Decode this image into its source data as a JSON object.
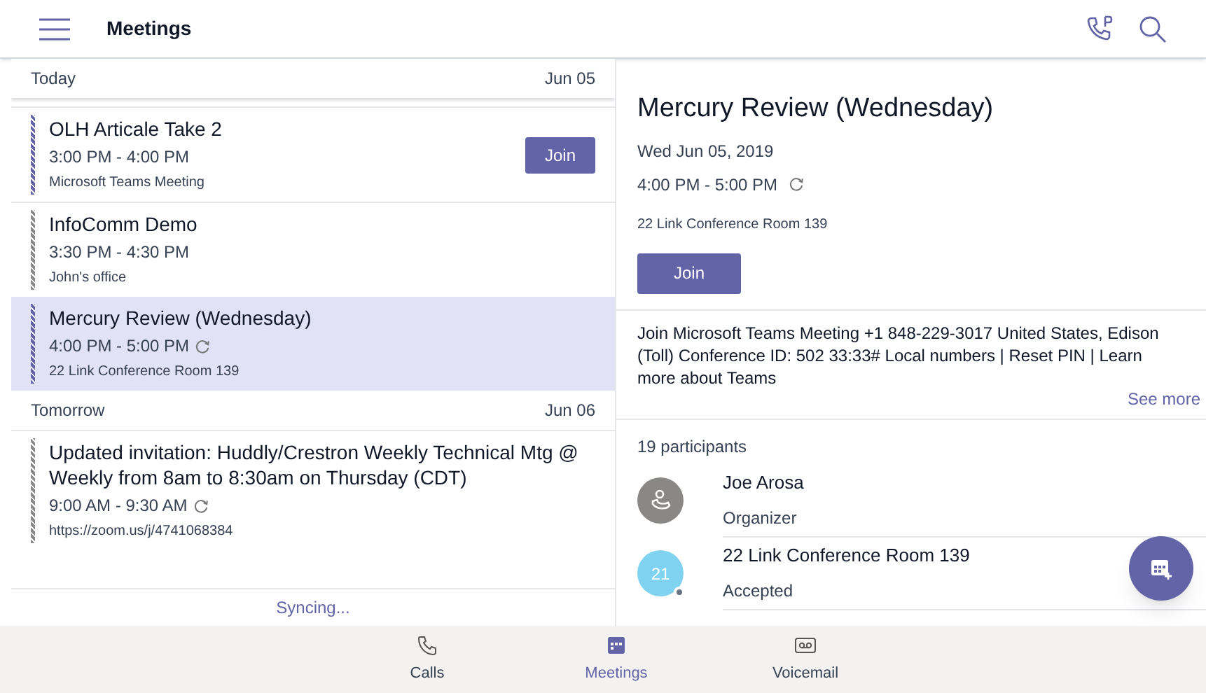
{
  "header": {
    "title": "Meetings"
  },
  "sections": [
    {
      "label": "Today",
      "date": "Jun 05",
      "meetings": [
        {
          "title": "OLH Articale Take 2",
          "time": "3:00 PM - 4:00 PM",
          "recurring": false,
          "location": "Microsoft Teams Meeting",
          "color": "#6264a7",
          "selected": false,
          "join": "Join"
        },
        {
          "title": "InfoComm Demo",
          "time": "3:30 PM - 4:30 PM",
          "recurring": false,
          "location": "John's office",
          "color": "#8a8a8a",
          "selected": false
        },
        {
          "title": "Mercury Review (Wednesday)",
          "time": "4:00 PM - 5:00 PM",
          "recurring": true,
          "location": "22 Link Conference Room 139",
          "color": "#6264a7",
          "selected": true
        }
      ]
    },
    {
      "label": "Tomorrow",
      "date": "Jun 06",
      "meetings": [
        {
          "title": "Updated invitation: Huddly/Crestron Weekly Technical Mtg @ Weekly from 8am to 8:30am on Thursday (CDT)",
          "time": "9:00 AM - 9:30 AM",
          "recurring": true,
          "location": "https://zoom.us/j/4741068384",
          "color": "#8a8a8a",
          "selected": false
        }
      ]
    }
  ],
  "sync_status": "Syncing...",
  "detail": {
    "title": "Mercury Review (Wednesday)",
    "date": "Wed Jun 05, 2019",
    "time": "4:00 PM - 5:00 PM",
    "recurring": true,
    "location": "22 Link Conference Room 139",
    "join": "Join",
    "description": "Join Microsoft Teams Meeting +1 848-229-3017 United States, Edison (Toll) Conference ID: 502 33:33# Local numbers | Reset PIN | Learn more about Teams",
    "see_more": "See more",
    "participant_count": "19 participants",
    "participants": [
      {
        "name": "Joe Arosa",
        "role": "Organizer",
        "kind": "icon"
      },
      {
        "name": "22 Link Conference Room 139",
        "role": "Accepted",
        "kind": "initials",
        "initials": "21"
      }
    ]
  },
  "nav": [
    {
      "label": "Calls",
      "kind": "phone",
      "selected": false
    },
    {
      "label": "Meetings",
      "kind": "calendar",
      "selected": true
    },
    {
      "label": "Voicemail",
      "kind": "voicemail",
      "selected": false
    }
  ]
}
